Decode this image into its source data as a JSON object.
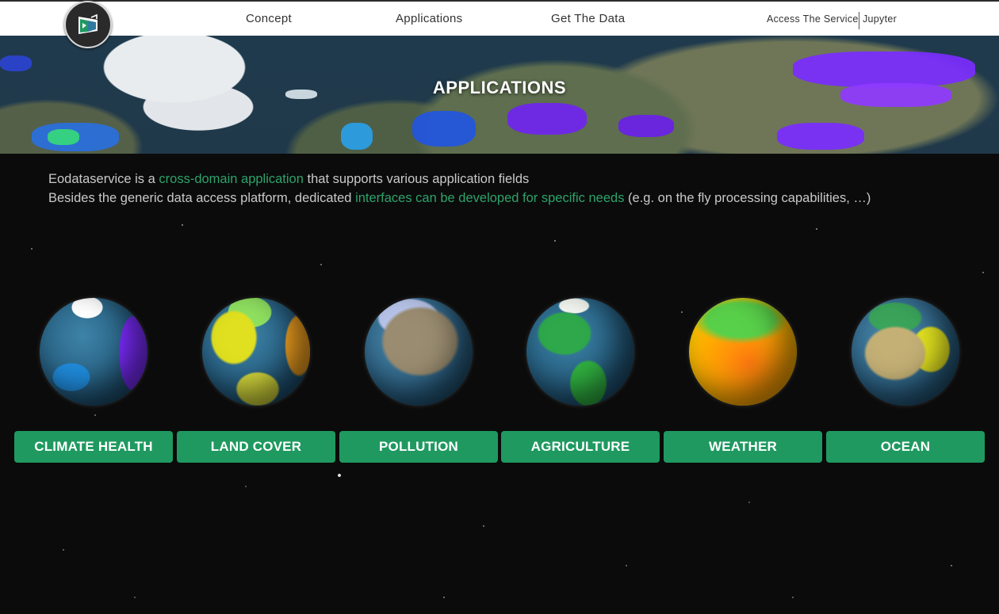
{
  "nav": {
    "links": [
      "Concept",
      "Applications",
      "Get The Data"
    ],
    "access_service": "Access The Service",
    "jupyter": "Jupyter"
  },
  "hero": {
    "title": "APPLICATIONS"
  },
  "intro": {
    "line1_prefix": "Eodataservice is a ",
    "line1_highlight": "cross-domain application",
    "line1_suffix": " that supports various application fields",
    "line2_prefix": "Besides the generic data access platform, dedicated ",
    "line2_highlight": "interfaces can be developed for specific needs",
    "line2_suffix": " (e.g. on the fly processing capabilities, …)"
  },
  "applications": [
    {
      "label": "CLIMATE HEALTH",
      "globe_icon": "climate-health-globe"
    },
    {
      "label": "LAND COVER",
      "globe_icon": "land-cover-globe"
    },
    {
      "label": "POLLUTION",
      "globe_icon": "pollution-globe"
    },
    {
      "label": "AGRICULTURE",
      "globe_icon": "agriculture-globe"
    },
    {
      "label": "WEATHER",
      "globe_icon": "weather-globe"
    },
    {
      "label": "OCEAN",
      "globe_icon": "ocean-globe"
    }
  ],
  "colors": {
    "accent": "#1f9960",
    "highlight_text": "#2ea36b",
    "background": "#0b0b0b"
  }
}
